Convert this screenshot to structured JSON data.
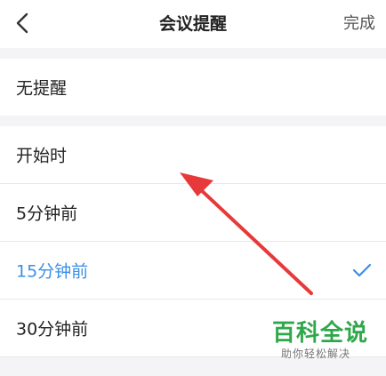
{
  "header": {
    "title": "会议提醒",
    "done_label": "完成"
  },
  "options": [
    {
      "label": "无提醒",
      "selected": false
    },
    {
      "label": "开始时",
      "selected": false
    },
    {
      "label": "5分钟前",
      "selected": false
    },
    {
      "label": "15分钟前",
      "selected": true
    },
    {
      "label": "30分钟前",
      "selected": false
    }
  ],
  "colors": {
    "selected": "#3b8fe6",
    "annotation_arrow": "#e8393a",
    "watermark": "#2ea84a"
  },
  "icons": {
    "back": "chevron-left-icon",
    "selected_mark": "checkmark-icon"
  },
  "watermark": {
    "title": "百科全说",
    "subtitle": "助你轻松解决"
  }
}
